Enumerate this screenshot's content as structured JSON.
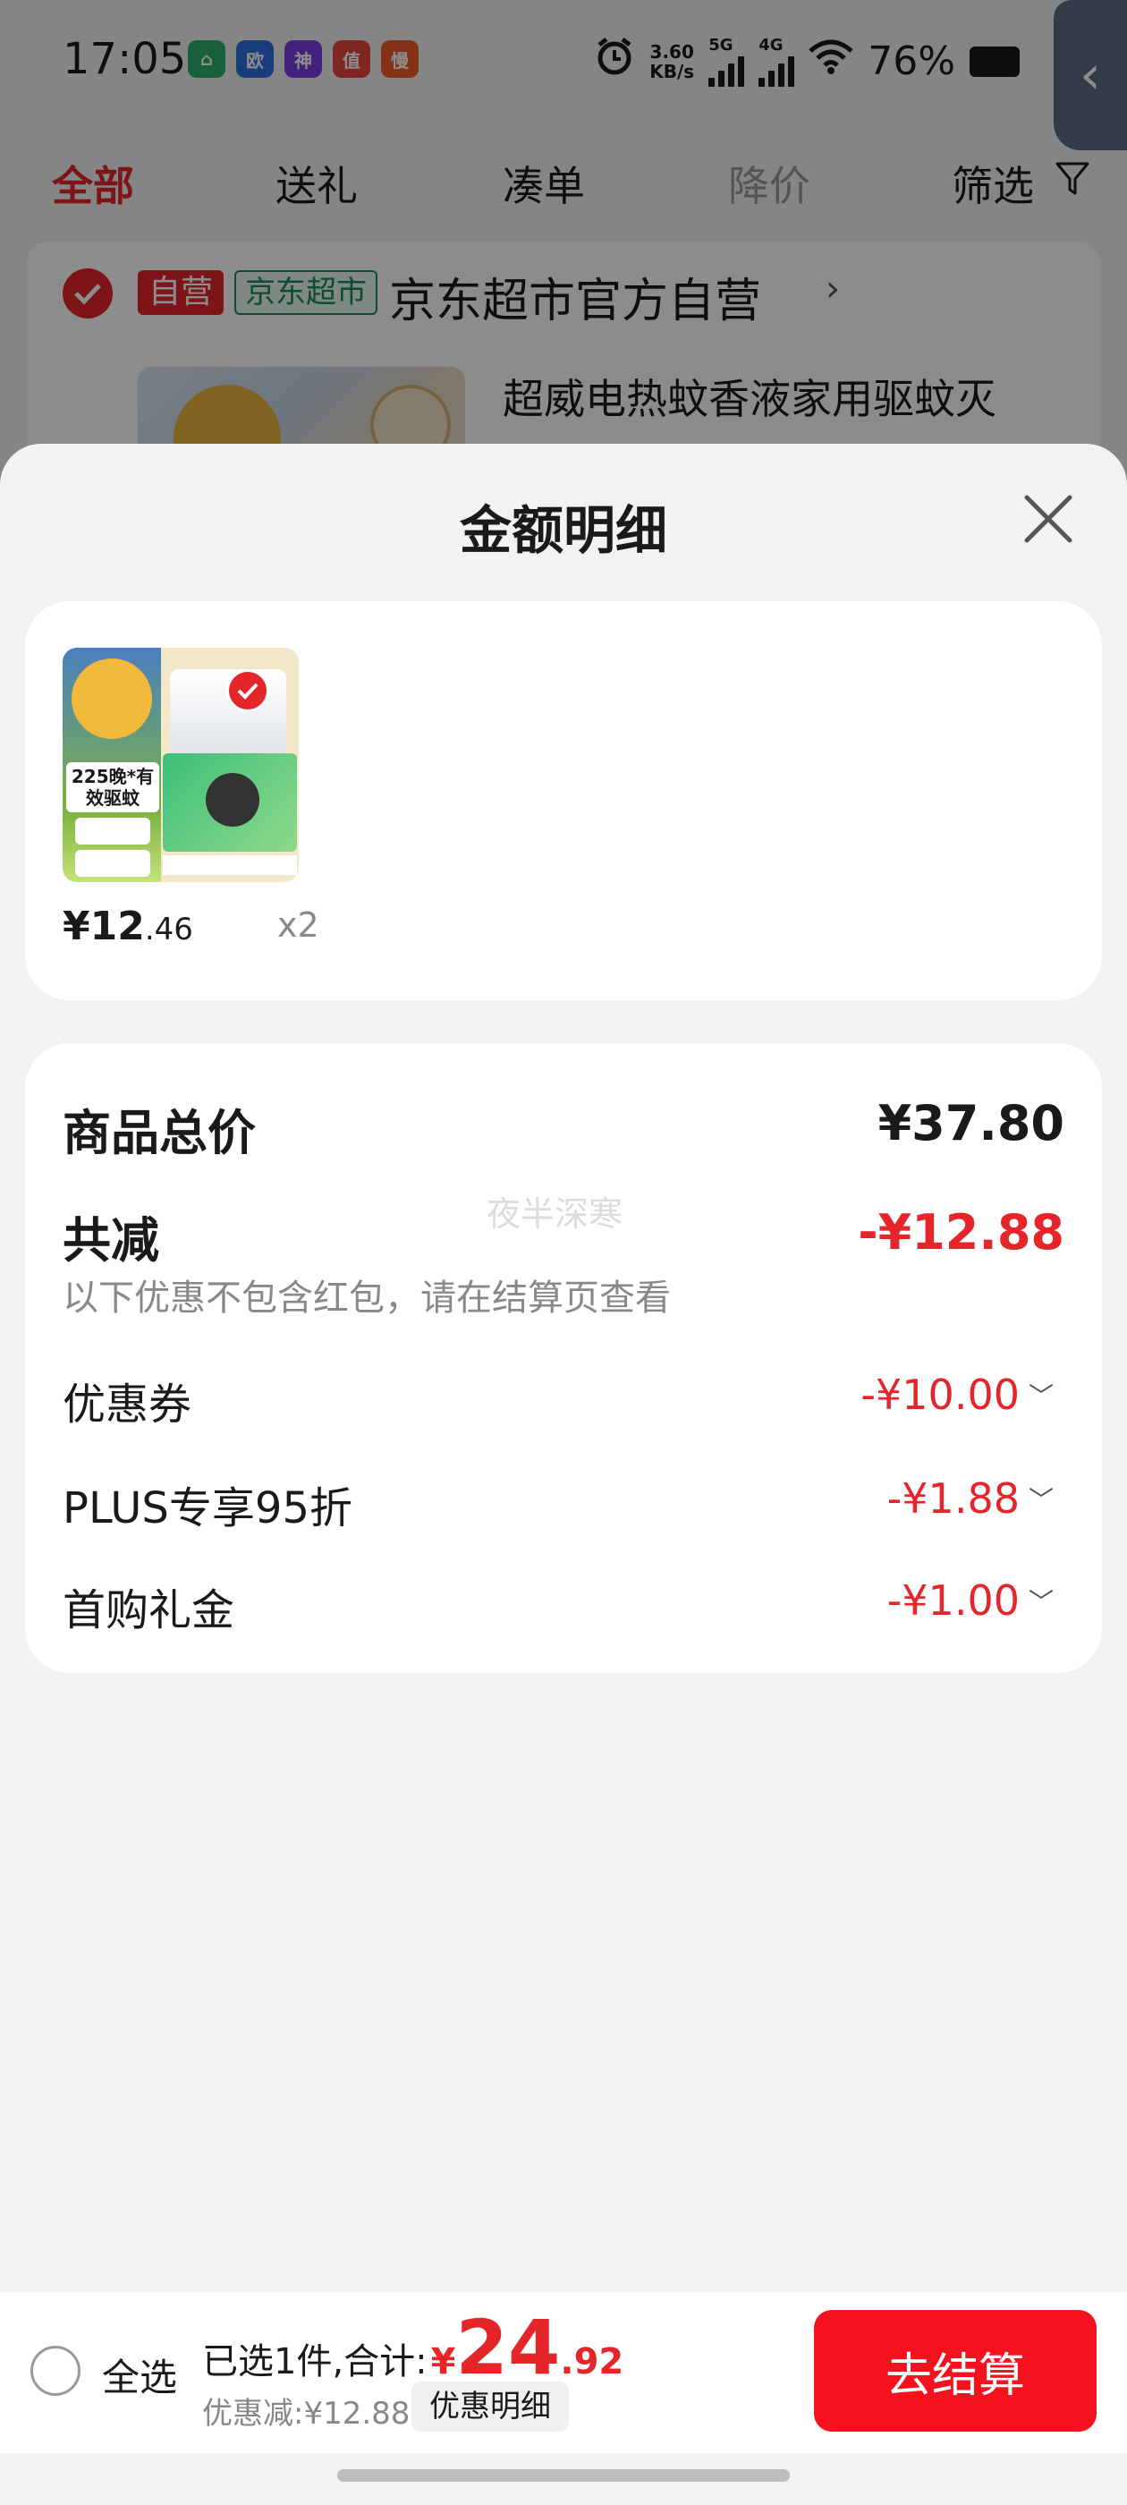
{
  "status_bar": {
    "time": "17:05",
    "app_icons": [
      {
        "name": "home-app-icon",
        "glyph": "⌂",
        "color": "#2fae6b"
      },
      {
        "name": "oppo-app-icon",
        "glyph": "欧",
        "color": "#2f6fe0"
      },
      {
        "name": "shenma-app-icon",
        "glyph": "神",
        "color": "#7b3ee6"
      },
      {
        "name": "zhi-app-icon",
        "glyph": "值",
        "color": "#e8453c"
      },
      {
        "name": "man-app-icon",
        "glyph": "慢",
        "color": "#f05a28"
      }
    ],
    "net_speed_value": "3.60",
    "net_speed_unit": "KB/s",
    "net_5g": "5G",
    "net_4g": "4G",
    "battery": "76%"
  },
  "filter_tabs": {
    "all": "全部",
    "gift": "送礼",
    "bundle": "凑单",
    "price_drop": "降价",
    "filter": "筛选"
  },
  "store": {
    "self_tag": "自营",
    "market_tag": "京东超市",
    "name": "京东超市官方自营",
    "chevron": "›",
    "product_title": "超威电热蚊香液家用驱蚊灭"
  },
  "sheet": {
    "title": "金额明细",
    "product": {
      "price_int": "¥12",
      "price_dec": ".46",
      "qty": "x2",
      "badge_text": "225晚*有效驱蚊"
    },
    "amounts": {
      "total_label": "商品总价",
      "total_value": "¥37.80",
      "reduce_label": "共减",
      "reduce_value": "-¥12.88",
      "reduce_note": "以下优惠不包含红包，请在结算页查看",
      "watermark": "夜半深寒",
      "discounts": [
        {
          "label": "优惠券",
          "value": "-¥10.00"
        },
        {
          "label": "PLUS专享95折",
          "value": "-¥1.88"
        },
        {
          "label": "首购礼金",
          "value": "-¥1.00"
        }
      ]
    }
  },
  "bottom_bar": {
    "select_all": "全选",
    "selected_text": "已选1件,合计:",
    "yen": "¥",
    "total_int": "24",
    "total_dec": ".92",
    "discount_text": "优惠减:¥12.88",
    "detail_chip": "优惠明细",
    "checkout": "去结算"
  },
  "colors": {
    "accent_red": "#e4262a",
    "checkout_red": "#f5121e",
    "market_green": "#1a8a5a"
  }
}
